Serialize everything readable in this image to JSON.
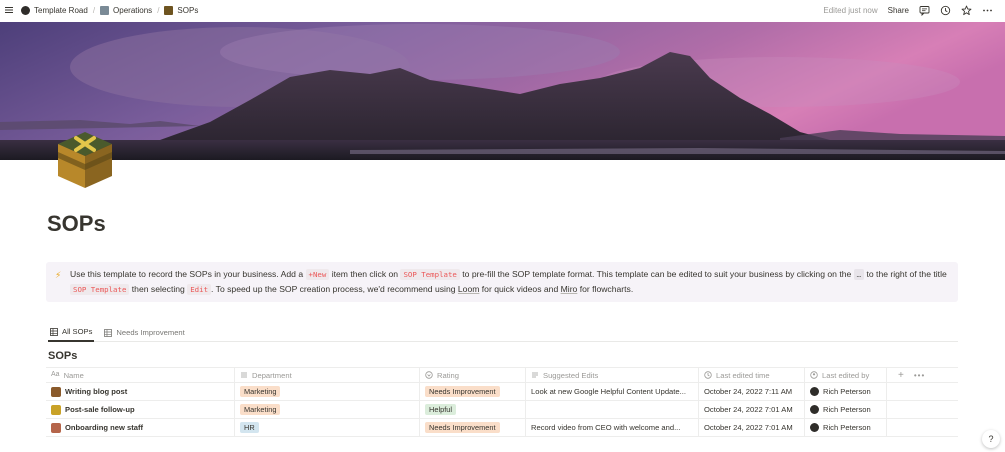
{
  "breadcrumb": [
    {
      "label": "Template Road",
      "icon": "template-road-icon"
    },
    {
      "label": "Operations",
      "icon": "operations-icon"
    },
    {
      "label": "SOPs",
      "icon": "cube-icon"
    }
  ],
  "topbar": {
    "edited": "Edited just now",
    "share": "Share"
  },
  "page": {
    "title": "SOPs"
  },
  "callout": {
    "icon": "⚡",
    "t1": "Use this template to record the SOPs in your business. Add a ",
    "code_new": "+New",
    "t2": " item then click on ",
    "code_sop": "SOP Template",
    "t3": " to pre-fill the SOP template format. This template can be edited to suit your business by clicking on the ",
    "code_dots": "…",
    "t4": " to the right of the title ",
    "code_sop2": "SOP Template",
    "t5": " then selecting ",
    "code_edit": "Edit",
    "t6": ". To speed up the SOP creation process, we'd recommend using ",
    "link_loom": "Loom",
    "t7": " for quick videos and ",
    "link_miro": "Miro",
    "t8": " for flowcharts."
  },
  "tabs": [
    {
      "label": "All SOPs",
      "active": true
    },
    {
      "label": "Needs Improvement",
      "active": false
    }
  ],
  "database": {
    "title": "SOPs",
    "columns": [
      "Name",
      "Department",
      "Rating",
      "Suggested Edits",
      "Last edited time",
      "Last edited by"
    ],
    "rows": [
      {
        "name": "Writing blog post",
        "emoji_color": "#8a5a2b",
        "department": "Marketing",
        "rating": "Needs Improvement",
        "suggested": "Look at new Google Helpful Content Update...",
        "time": "October 24, 2022 7:11 AM",
        "by": "Rich Peterson"
      },
      {
        "name": "Post-sale follow-up",
        "emoji_color": "#c9a227",
        "department": "Marketing",
        "rating": "Helpful",
        "suggested": "",
        "time": "October 24, 2022 7:01 AM",
        "by": "Rich Peterson"
      },
      {
        "name": "Onboarding new staff",
        "emoji_color": "#b5654a",
        "department": "HR",
        "rating": "Needs Improvement",
        "suggested": "Record video from CEO with welcome and...",
        "time": "October 24, 2022 7:01 AM",
        "by": "Rich Peterson"
      }
    ]
  },
  "colors": {
    "orange_tag": "#fadec9",
    "green_tag": "#dbeddb",
    "blue_tag": "#d3e5ef"
  },
  "help": "?"
}
